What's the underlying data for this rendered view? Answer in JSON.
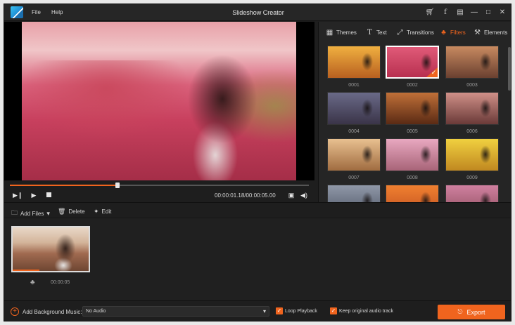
{
  "app": {
    "title": "Slideshow Creator",
    "brand_color": "#f0641e"
  },
  "menu": {
    "file": "File",
    "help": "Help"
  },
  "titlebar_icons": [
    "cart-icon",
    "facebook-icon",
    "chat-icon",
    "minimize-icon",
    "maximize-icon",
    "close-icon"
  ],
  "player": {
    "time": "00:00:01.18/00:00:05.00",
    "progress": 0.36
  },
  "tabs": [
    {
      "label": "Themes",
      "icon": "themes-icon",
      "active": false
    },
    {
      "label": "Text",
      "icon": "text-icon",
      "active": false
    },
    {
      "label": "Transitions",
      "icon": "transitions-icon",
      "active": false
    },
    {
      "label": "Filters",
      "icon": "filters-icon",
      "active": true
    },
    {
      "label": "Elements",
      "icon": "elements-icon",
      "active": false
    }
  ],
  "filters": [
    {
      "label": "0001",
      "colors": [
        "#f0b040",
        "#b86020"
      ]
    },
    {
      "label": "0002",
      "colors": [
        "#e05a78",
        "#b83050"
      ],
      "selected": true
    },
    {
      "label": "0003",
      "colors": [
        "#c88a60",
        "#6a4030"
      ]
    },
    {
      "label": "0004",
      "colors": [
        "#6a6a88",
        "#3a3448"
      ]
    },
    {
      "label": "0005",
      "colors": [
        "#c07038",
        "#5a2a14"
      ]
    },
    {
      "label": "0006",
      "colors": [
        "#d09088",
        "#6a3a38"
      ]
    },
    {
      "label": "0007",
      "colors": [
        "#e8c090",
        "#a06c40"
      ]
    },
    {
      "label": "0008",
      "colors": [
        "#e8a8c0",
        "#a86478"
      ]
    },
    {
      "label": "0009",
      "colors": [
        "#f0d040",
        "#c08820"
      ]
    },
    {
      "label": "",
      "colors": [
        "#9098a8",
        "#505868"
      ]
    },
    {
      "label": "",
      "colors": [
        "#f08030",
        "#c05020"
      ]
    },
    {
      "label": "",
      "colors": [
        "#d080a0",
        "#905060"
      ]
    }
  ],
  "toolbar": {
    "add_files": "Add Files",
    "delete": "Delete",
    "edit": "Edit"
  },
  "storyboard": {
    "clip_time": "00:00:05"
  },
  "bottom": {
    "bgm_label": "Add Background Music:",
    "audio_value": "No Audio",
    "loop": "Loop Playback",
    "keep_audio": "Keep original audio track",
    "export": "Export"
  }
}
